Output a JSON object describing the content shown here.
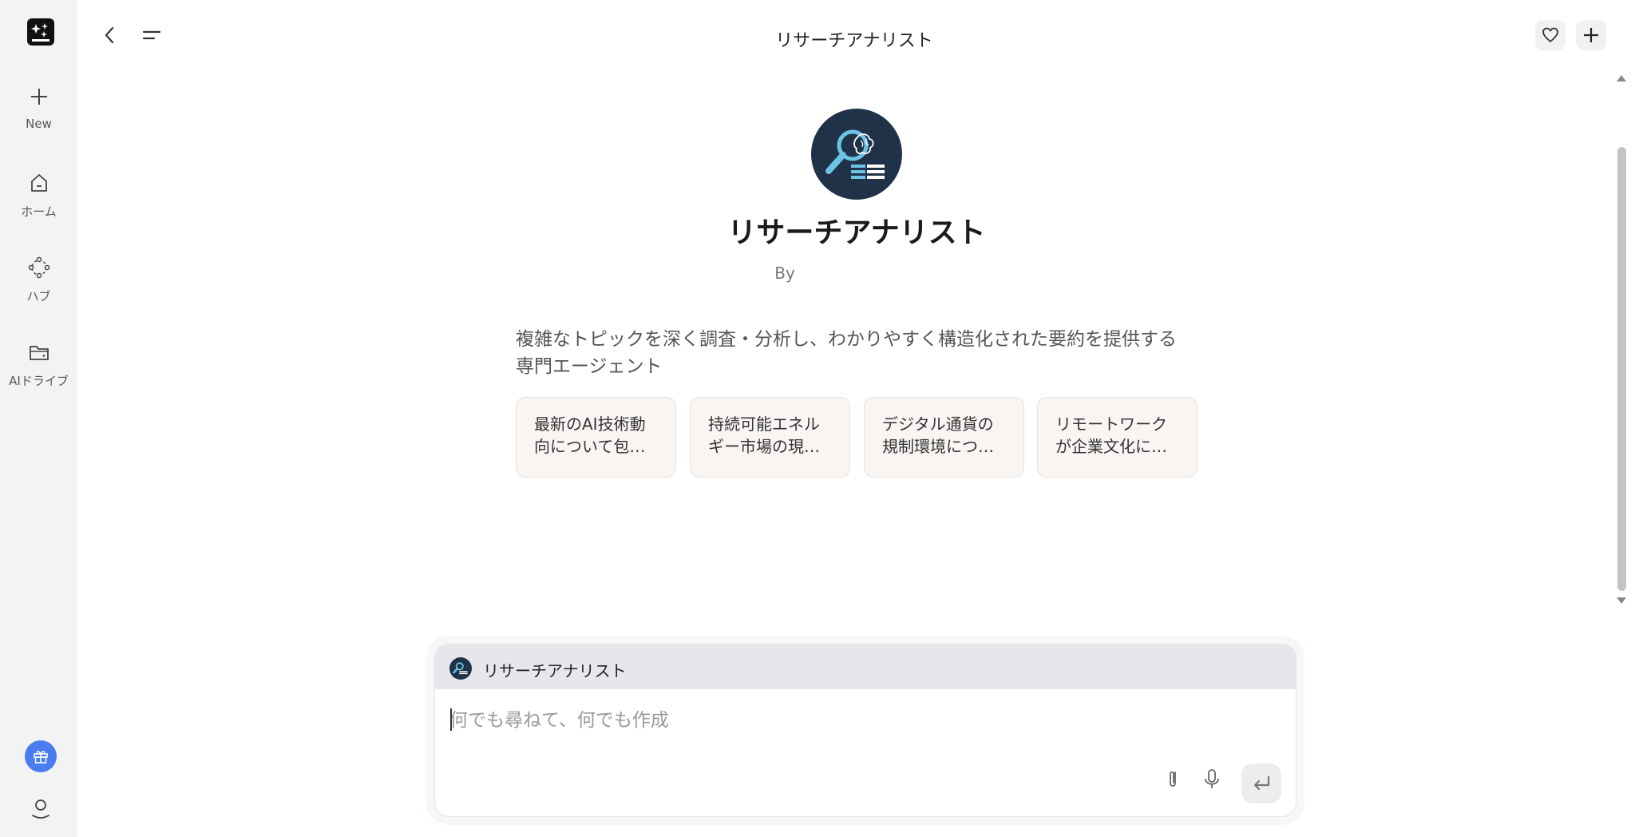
{
  "header": {
    "title": "リサーチアナリスト"
  },
  "sidebar": {
    "items": [
      {
        "label": "New",
        "icon": "plus-icon"
      },
      {
        "label": "ホーム",
        "icon": "home-icon"
      },
      {
        "label": "ハブ",
        "icon": "hub-icon"
      },
      {
        "label": "AIドライブ",
        "icon": "folder-icon"
      }
    ]
  },
  "agent": {
    "name": "リサーチアナリスト",
    "by": "By",
    "description": "複雑なトピックを深く調査・分析し、わかりやすく構造化された要約を提供する専門エージェント"
  },
  "suggestions": [
    "最新のAI技術動向について包…",
    "持続可能エネルギー市場の現…",
    "デジタル通貨の規制環境につ…",
    "リモートワークが企業文化に…"
  ],
  "composer": {
    "agent_name": "リサーチアナリスト",
    "placeholder": "何でも尋ねて、何でも作成"
  },
  "colors": {
    "rail_bg": "#f3f3f3",
    "avatar_bg": "#1f3248",
    "gift_accent": "#4a7cf0",
    "card_bg": "#f8f5f2",
    "composer_head_bg": "#e6e7ea"
  }
}
